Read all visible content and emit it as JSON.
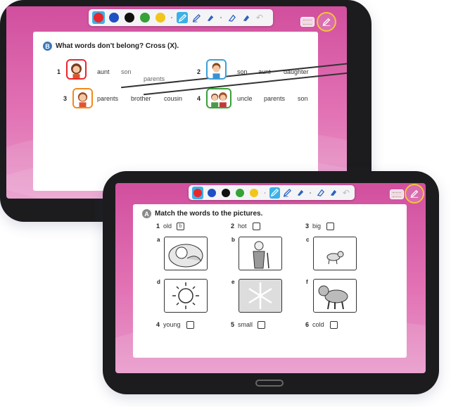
{
  "toolbar": {
    "colors": [
      "#e8262d",
      "#1f4fc4",
      "#111111",
      "#34a334",
      "#f2c51b"
    ],
    "selected_color": "#e8262d",
    "tools": [
      "pen-tool",
      "highlighter-tool",
      "marker-tool",
      "eraser-tool",
      "clear-eraser-tool",
      "undo-tool"
    ]
  },
  "top_tablet": {
    "badge": "B",
    "instruction": "What words don't belong? Cross (X).",
    "items": [
      {
        "num": "1",
        "words": [
          "aunt",
          "son",
          "parents"
        ],
        "crossed": [
          false,
          true,
          true
        ]
      },
      {
        "num": "2",
        "words": [
          "son",
          "aunt",
          "daughter"
        ],
        "crossed": [
          false,
          false,
          false
        ]
      },
      {
        "num": "3",
        "words": [
          "parents",
          "brother",
          "cousin"
        ],
        "crossed": [
          false,
          false,
          false
        ]
      },
      {
        "num": "4",
        "words": [
          "uncle",
          "parents",
          "son"
        ],
        "crossed": [
          false,
          false,
          false
        ]
      }
    ],
    "avatar_border_colors": [
      "#e8262d",
      "#3aa0d8",
      "#f08a1c",
      "#3aa03a"
    ]
  },
  "bottom_tablet": {
    "badge": "A",
    "instruction": "Match the words to the pictures.",
    "top_words": [
      {
        "num": "1",
        "word": "old",
        "answer": "b"
      },
      {
        "num": "2",
        "word": "hot",
        "answer": ""
      },
      {
        "num": "3",
        "word": "big",
        "answer": ""
      }
    ],
    "picture_labels": [
      "a",
      "b",
      "c",
      "d",
      "e",
      "f"
    ],
    "picture_subjects": [
      "baby-icon",
      "old-man-icon",
      "small-dog-icon",
      "sun-icon",
      "snowflake-icon",
      "big-dog-icon"
    ],
    "bottom_words": [
      {
        "num": "4",
        "word": "young",
        "answer": ""
      },
      {
        "num": "5",
        "word": "small",
        "answer": ""
      },
      {
        "num": "6",
        "word": "cold",
        "answer": ""
      }
    ]
  }
}
